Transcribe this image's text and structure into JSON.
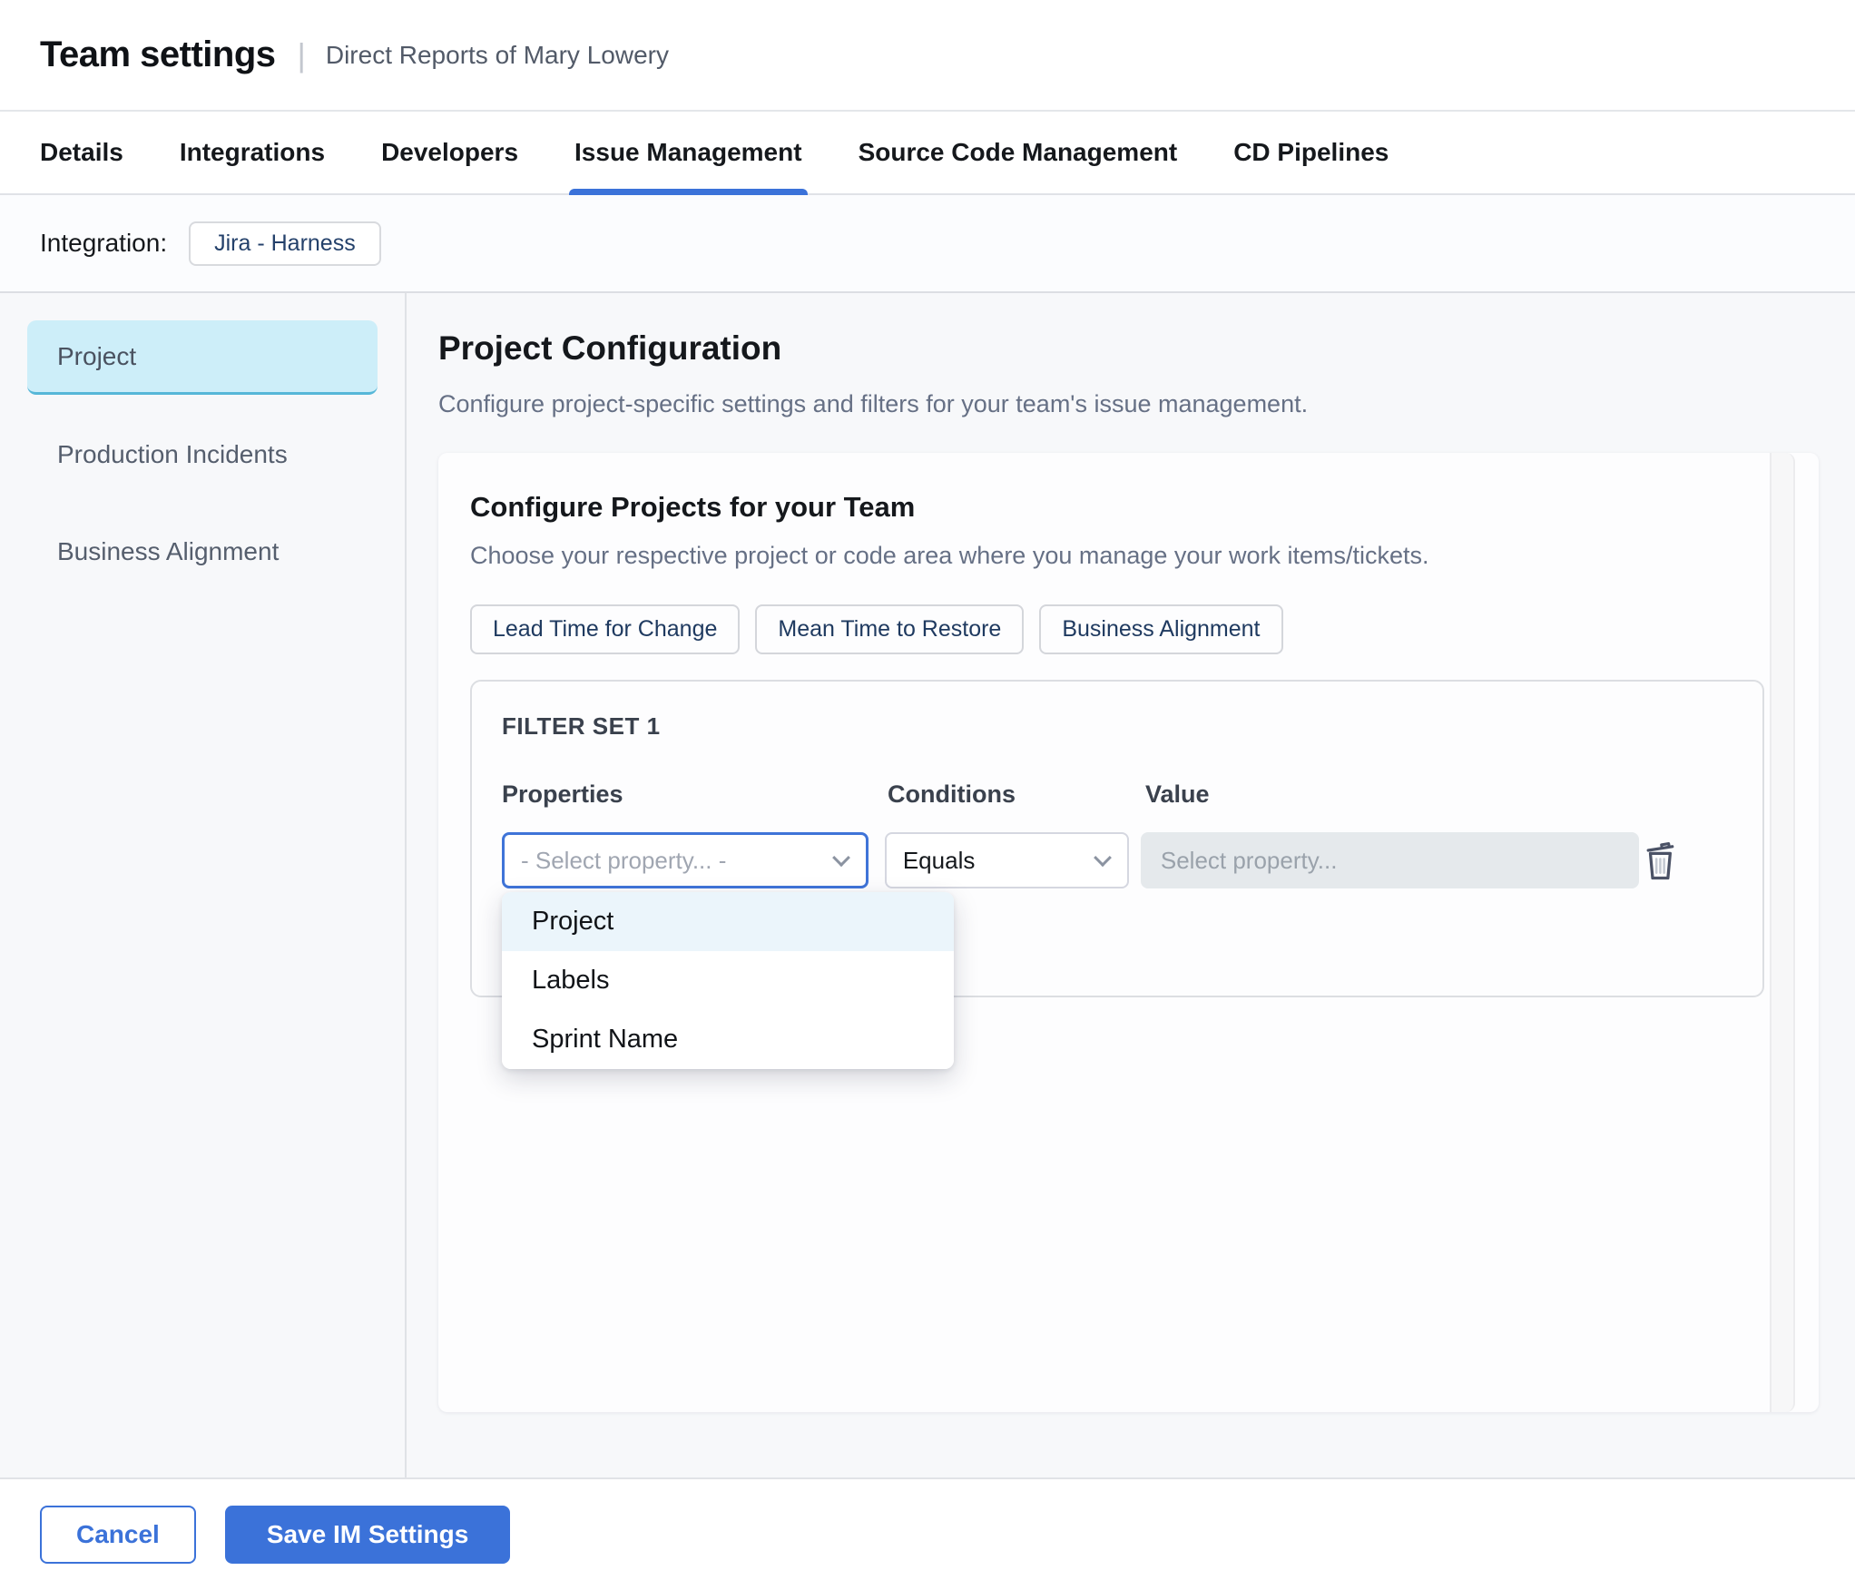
{
  "header": {
    "title": "Team settings",
    "subtitle": "Direct Reports of Mary Lowery"
  },
  "tabs": [
    {
      "label": "Details",
      "active": false
    },
    {
      "label": "Integrations",
      "active": false
    },
    {
      "label": "Developers",
      "active": false
    },
    {
      "label": "Issue Management",
      "active": true
    },
    {
      "label": "Source Code Management",
      "active": false
    },
    {
      "label": "CD Pipelines",
      "active": false
    }
  ],
  "integration": {
    "label": "Integration:",
    "chip": "Jira - Harness"
  },
  "sidebar": {
    "items": [
      {
        "label": "Project",
        "selected": true
      },
      {
        "label": "Production Incidents",
        "selected": false
      },
      {
        "label": "Business Alignment",
        "selected": false
      }
    ]
  },
  "main": {
    "title": "Project Configuration",
    "description": "Configure project-specific settings and filters for your team's issue management.",
    "card": {
      "title": "Configure Projects for your Team",
      "description": "Choose your respective project or code area where you manage your work items/tickets.",
      "chips": [
        "Lead Time for Change",
        "Mean Time to Restore",
        "Business Alignment"
      ],
      "filter_set": {
        "title": "FILTER SET 1",
        "columns": {
          "properties": "Properties",
          "conditions": "Conditions",
          "value": "Value"
        },
        "property_select": {
          "value": "- Select property... -"
        },
        "condition_select": {
          "value": "Equals"
        },
        "value_input": {
          "placeholder": "Select property..."
        },
        "dropdown": {
          "options": [
            {
              "label": "Project",
              "highlighted": true
            },
            {
              "label": "Labels",
              "highlighted": false
            },
            {
              "label": "Sprint Name",
              "highlighted": false
            }
          ]
        }
      }
    }
  },
  "footer": {
    "cancel_label": "Cancel",
    "save_label": "Save IM Settings"
  },
  "colors": {
    "accent_blue": "#3b72d9",
    "sidebar_selected_bg": "#cdeef9",
    "sidebar_selected_border": "#56b7d8",
    "dropdown_highlight": "#ebf5fb",
    "chip_text": "#1f3a60",
    "value_input_bg": "#e5e9ec"
  }
}
